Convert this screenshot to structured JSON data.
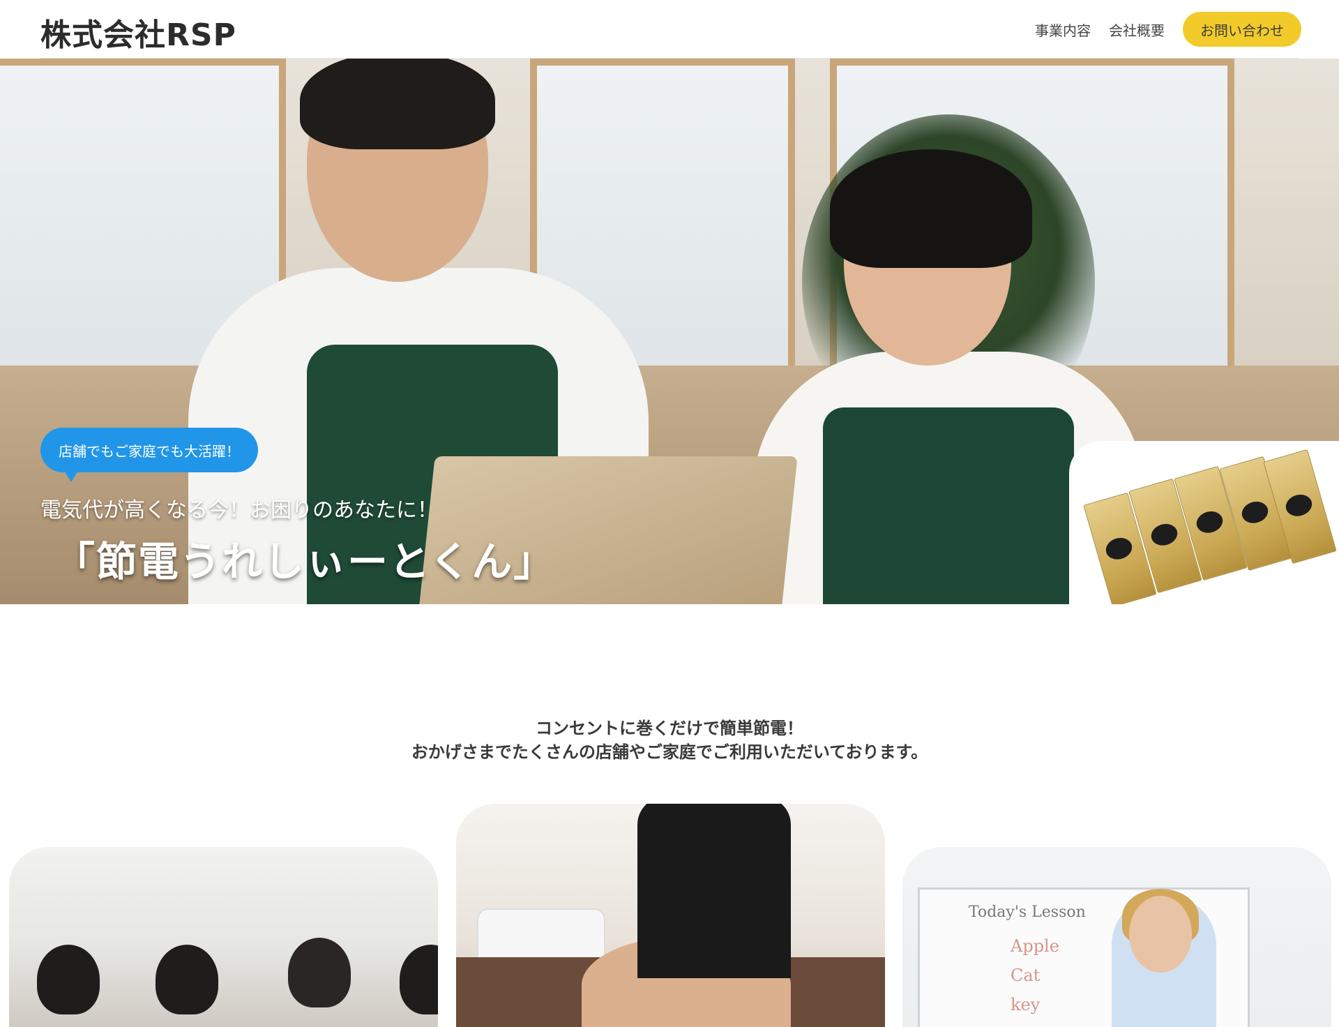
{
  "header": {
    "logo": "株式会社RSP",
    "nav": [
      {
        "label": "事業内容"
      },
      {
        "label": "会社概要"
      }
    ],
    "cta": "お問い合わせ"
  },
  "hero": {
    "bubble": "店舗でもご家庭でも大活躍！",
    "subtitle": "電気代が高くなる今！お困りのあなたに！",
    "title": "「節電うれしぃーとくん」"
  },
  "intro": {
    "line1": "コンセントに巻くだけで簡単節電！",
    "line2": "おかげさまでたくさんの店舗やご家庭でご利用いただいております。"
  },
  "cards": [
    {
      "subject": "classroom"
    },
    {
      "subject": "esthetic-salon"
    },
    {
      "subject": "english-lesson",
      "board_title": "Today's Lesson",
      "board_words": [
        "Apple",
        "Cat",
        "key"
      ]
    }
  ],
  "colors": {
    "accent": "#f2cb2b",
    "bubble": "#2196e8"
  }
}
